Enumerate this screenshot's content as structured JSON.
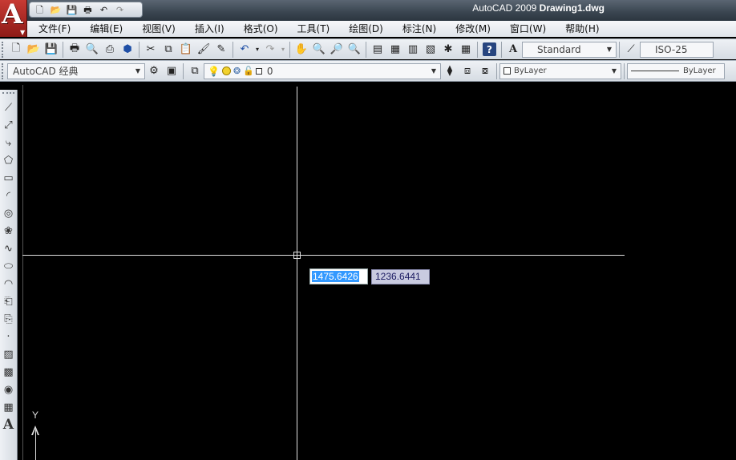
{
  "titlebar": {
    "app_name": "AutoCAD 2009",
    "document": "Drawing1.dwg",
    "logo_letter": "A"
  },
  "menubar": {
    "items": [
      {
        "label": "文件(F)"
      },
      {
        "label": "编辑(E)"
      },
      {
        "label": "视图(V)"
      },
      {
        "label": "插入(I)"
      },
      {
        "label": "格式(O)"
      },
      {
        "label": "工具(T)"
      },
      {
        "label": "绘图(D)"
      },
      {
        "label": "标注(N)"
      },
      {
        "label": "修改(M)"
      },
      {
        "label": "窗口(W)"
      },
      {
        "label": "帮助(H)"
      }
    ]
  },
  "toolbar": {
    "text_style": "Standard",
    "dim_style": "ISO-25",
    "help_label": "?"
  },
  "toolbar2": {
    "workspace": "AutoCAD 经典",
    "layer_name": "0",
    "color": "ByLayer",
    "linetype": "ByLayer"
  },
  "drawbar": {
    "text_tool_label": "A"
  },
  "canvas": {
    "dynamic_input_x": "1475.6426",
    "dynamic_input_y": "1236.6441",
    "ucs_label": "Y"
  },
  "colors": {
    "canvas_bg": "#000000",
    "crosshair": "#e0e0e0",
    "input_highlight": "#3399ff",
    "logo_red": "#c73a34"
  }
}
